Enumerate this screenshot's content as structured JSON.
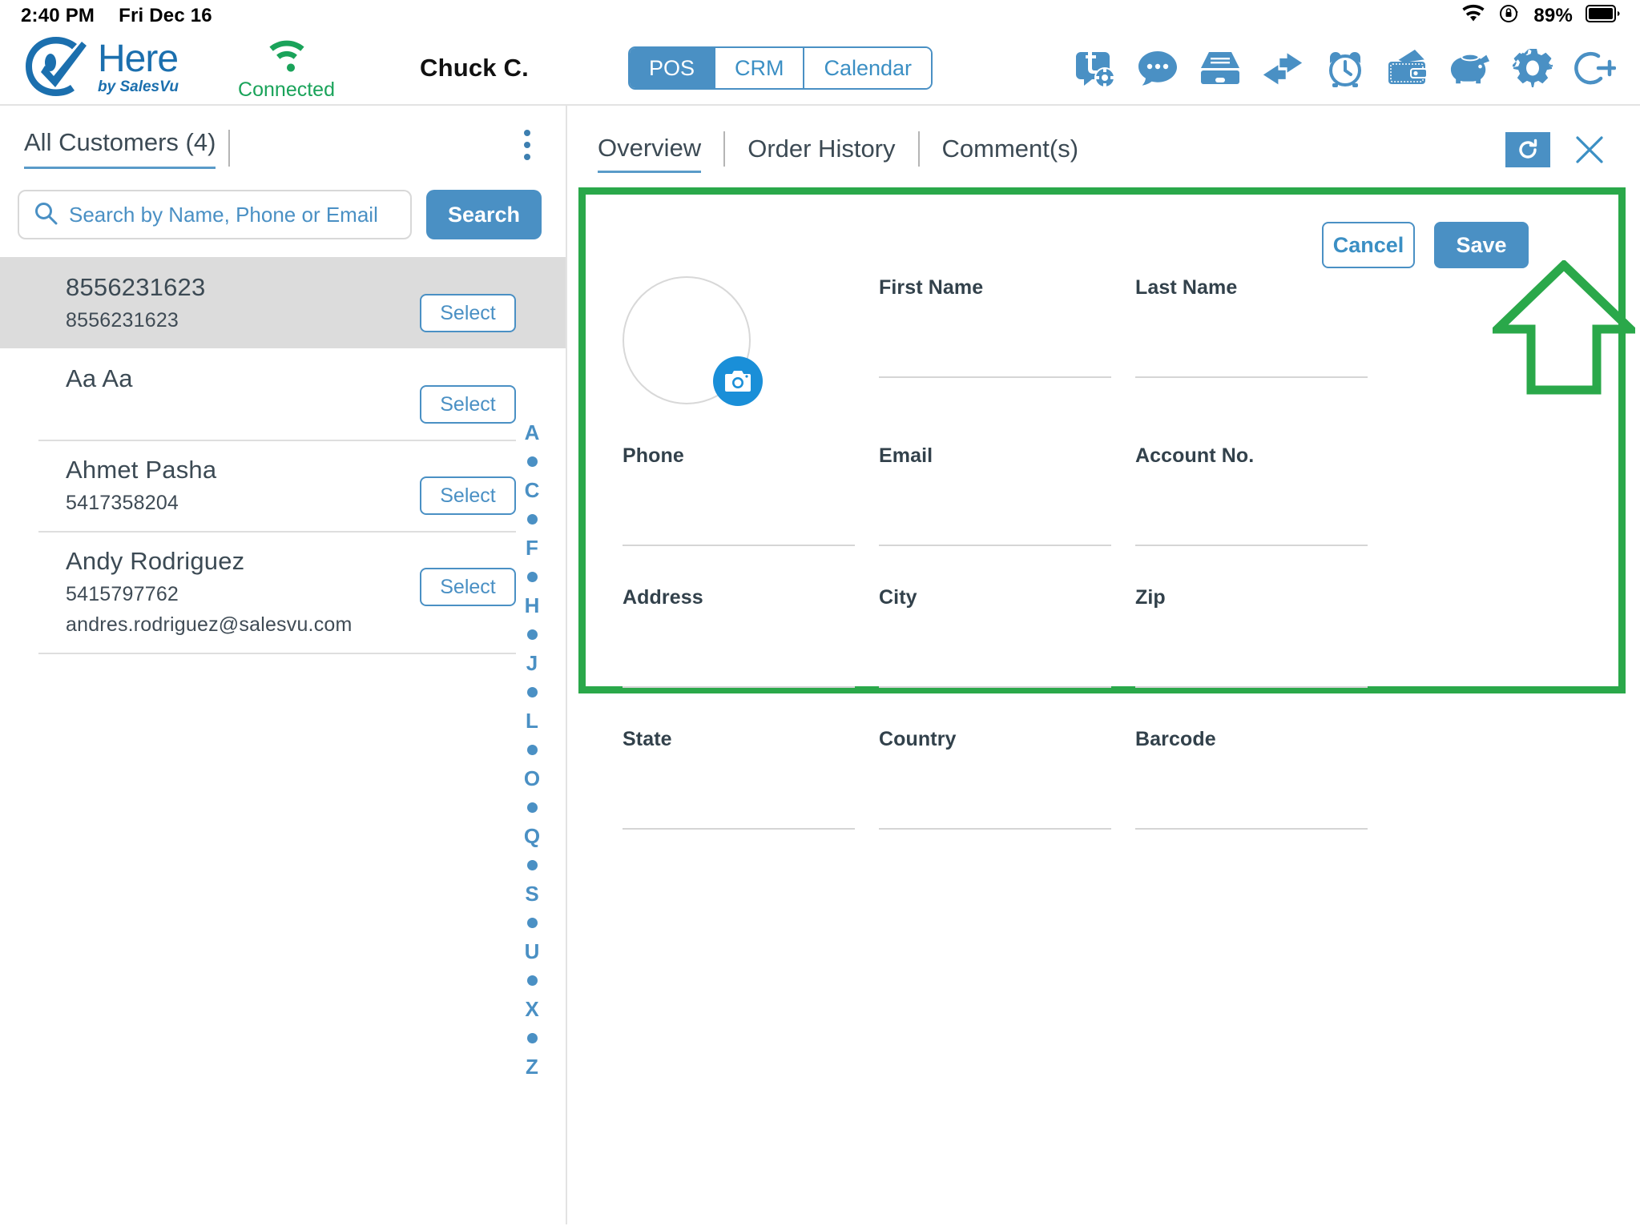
{
  "statusbar": {
    "time": "2:40 PM",
    "date": "Fri Dec 16",
    "battery_pct": "89%",
    "wifi_icon": "wifi-icon",
    "orientation_lock_icon": "rotation-lock-icon",
    "battery_icon": "battery-icon"
  },
  "topnav": {
    "brand_name": "Here",
    "brand_tagline": "by SalesVu",
    "logo_icon": "checkmark-logo-icon",
    "connection_icon": "wifi-signal-icon",
    "connection_label": "Connected",
    "connection_color": "#1aa35a",
    "user_name": "Chuck C.",
    "segments": [
      {
        "label": "POS",
        "active": true
      },
      {
        "label": "CRM",
        "active": false
      },
      {
        "label": "Calendar",
        "active": false
      }
    ],
    "toolbar_icons": [
      "tickets-settings-icon",
      "chat-bubble-icon",
      "file-drawer-icon",
      "exchange-arrows-icon",
      "alarm-clock-icon",
      "wallet-cash-icon",
      "piggy-bank-icon",
      "gear-icon",
      "logout-icon"
    ]
  },
  "left_panel": {
    "title": "All Customers (4)",
    "kebab_menu_icon": "more-vertical-icon",
    "search": {
      "icon": "search-icon",
      "placeholder": "Search by Name, Phone or Email",
      "value": "",
      "button_label": "Search"
    },
    "customers": [
      {
        "name": "8556231623",
        "phone": "8556231623",
        "email": "",
        "select_label": "Select",
        "selected": true
      },
      {
        "name": "Aa Aa",
        "phone": "",
        "email": "",
        "select_label": "Select",
        "selected": false
      },
      {
        "name": "Ahmet Pasha",
        "phone": "5417358204",
        "email": "",
        "select_label": "Select",
        "selected": false
      },
      {
        "name": "Andy Rodriguez",
        "phone": "5415797762",
        "email": "andres.rodriguez@salesvu.com",
        "select_label": "Select",
        "selected": false
      }
    ],
    "alpha_index": [
      "A",
      "•",
      "C",
      "•",
      "F",
      "•",
      "H",
      "•",
      "J",
      "•",
      "L",
      "•",
      "O",
      "•",
      "Q",
      "•",
      "S",
      "•",
      "U",
      "•",
      "X",
      "•",
      "Z"
    ]
  },
  "right_panel": {
    "tabs": [
      {
        "label": "Overview",
        "active": true
      },
      {
        "label": "Order History",
        "active": false
      },
      {
        "label": "Comment(s)",
        "active": false
      }
    ],
    "refresh_icon": "refresh-icon",
    "close_icon": "close-icon",
    "form": {
      "cancel_label": "Cancel",
      "save_label": "Save",
      "avatar_icon": "avatar-placeholder-icon",
      "camera_icon": "camera-icon",
      "fields": [
        {
          "label": "First Name",
          "value": ""
        },
        {
          "label": "Last Name",
          "value": ""
        },
        {
          "label": "Phone",
          "value": ""
        },
        {
          "label": "Email",
          "value": ""
        },
        {
          "label": "Account No.",
          "value": ""
        },
        {
          "label": "Address",
          "value": ""
        },
        {
          "label": "City",
          "value": ""
        },
        {
          "label": "Zip",
          "value": ""
        },
        {
          "label": "State",
          "value": ""
        },
        {
          "label": "Country",
          "value": ""
        },
        {
          "label": "Barcode",
          "value": ""
        }
      ],
      "highlight_color": "#2aa84a",
      "annotation_arrow_icon": "up-arrow-annotation-icon"
    }
  },
  "colors": {
    "accent_blue": "#4a90c4",
    "brand_blue": "#1b6fae",
    "green": "#2aa84a",
    "text_dark": "#3c4a54"
  }
}
